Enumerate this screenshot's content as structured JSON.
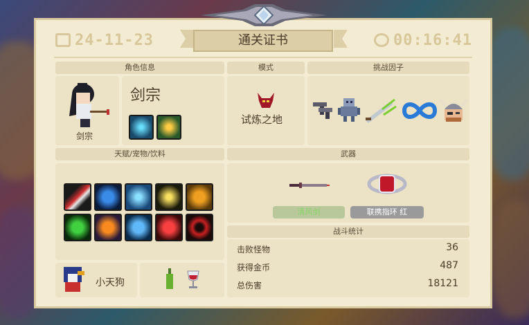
{
  "header": {
    "date": "24-11-23",
    "title": "通关证书",
    "time": "00:16:41"
  },
  "character": {
    "section": "角色信息",
    "name": "剑宗",
    "caption": "剑宗",
    "skills": [
      "sword-skill-icon",
      "summon-skill-icon"
    ]
  },
  "mode": {
    "section": "模式",
    "name": "试炼之地",
    "icon": "demon-horn-icon"
  },
  "challenge": {
    "section": "挑战因子",
    "factors": [
      "pistols-icon",
      "robot-icon",
      "green-sword-icon",
      "infinity-icon",
      "viking-helmet-icon"
    ]
  },
  "talents": {
    "section": "天赋/宠物/饮料",
    "grid": [
      [
        "slash-talent-icon",
        "blue-shield-talent-icon",
        "arrow-up-talent-icon",
        "lightning-talent-icon",
        "gold-shield-talent-icon"
      ],
      [
        "green-shield-talent-icon",
        "orange-shield-talent-icon",
        "brain-talent-icon",
        "heal-talent-icon",
        "target-talent-icon"
      ]
    ],
    "pet_name": "小天狗",
    "drinks": [
      "green-bottle-icon",
      "wine-glass-icon"
    ]
  },
  "weapons": {
    "section": "武器",
    "items": [
      {
        "name": "清风剑",
        "icon": "wind-sword-icon",
        "color": "#8ad46a"
      },
      {
        "name": "联携指环 红",
        "icon": "red-ring-icon",
        "color": "#ffffff"
      }
    ]
  },
  "stats": {
    "section": "战斗统计",
    "rows": [
      {
        "label": "击败怪物",
        "value": "36"
      },
      {
        "label": "获得金币",
        "value": "487"
      },
      {
        "label": "总伤害",
        "value": "18121"
      }
    ]
  },
  "colors": {
    "parchment": "#f3ebd2",
    "panel": "#ece2c5",
    "header_text": "#d7c79a"
  }
}
